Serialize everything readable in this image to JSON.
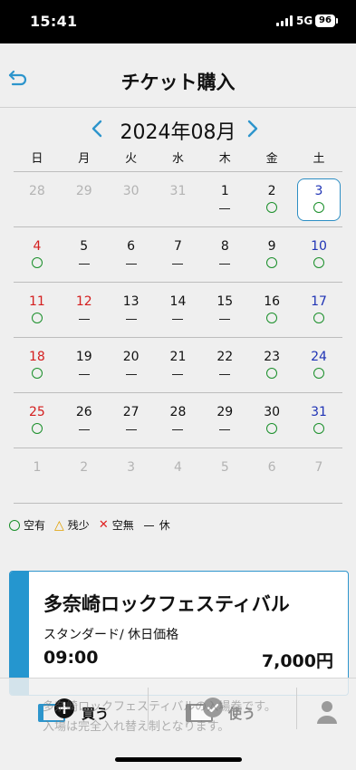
{
  "status_bar": {
    "time": "15:41",
    "network": "5G",
    "battery": "96"
  },
  "header": {
    "title": "チケット購入"
  },
  "calendar": {
    "month_label": "2024年08月",
    "weekdays": [
      "日",
      "月",
      "火",
      "水",
      "木",
      "金",
      "土"
    ],
    "weeks": [
      [
        {
          "d": "28",
          "s": "",
          "t": "muted"
        },
        {
          "d": "29",
          "s": "",
          "t": "muted"
        },
        {
          "d": "30",
          "s": "",
          "t": "muted"
        },
        {
          "d": "31",
          "s": "",
          "t": "muted"
        },
        {
          "d": "1",
          "s": "—",
          "t": ""
        },
        {
          "d": "2",
          "s": "○",
          "t": ""
        },
        {
          "d": "3",
          "s": "○",
          "t": "sat selected"
        }
      ],
      [
        {
          "d": "4",
          "s": "○",
          "t": "sun"
        },
        {
          "d": "5",
          "s": "—",
          "t": ""
        },
        {
          "d": "6",
          "s": "—",
          "t": ""
        },
        {
          "d": "7",
          "s": "—",
          "t": ""
        },
        {
          "d": "8",
          "s": "—",
          "t": ""
        },
        {
          "d": "9",
          "s": "○",
          "t": ""
        },
        {
          "d": "10",
          "s": "○",
          "t": "sat"
        }
      ],
      [
        {
          "d": "11",
          "s": "○",
          "t": "sun"
        },
        {
          "d": "12",
          "s": "—",
          "t": "sun"
        },
        {
          "d": "13",
          "s": "—",
          "t": ""
        },
        {
          "d": "14",
          "s": "—",
          "t": ""
        },
        {
          "d": "15",
          "s": "—",
          "t": ""
        },
        {
          "d": "16",
          "s": "○",
          "t": ""
        },
        {
          "d": "17",
          "s": "○",
          "t": "sat"
        }
      ],
      [
        {
          "d": "18",
          "s": "○",
          "t": "sun"
        },
        {
          "d": "19",
          "s": "—",
          "t": ""
        },
        {
          "d": "20",
          "s": "—",
          "t": ""
        },
        {
          "d": "21",
          "s": "—",
          "t": ""
        },
        {
          "d": "22",
          "s": "—",
          "t": ""
        },
        {
          "d": "23",
          "s": "○",
          "t": ""
        },
        {
          "d": "24",
          "s": "○",
          "t": "sat"
        }
      ],
      [
        {
          "d": "25",
          "s": "○",
          "t": "sun"
        },
        {
          "d": "26",
          "s": "—",
          "t": ""
        },
        {
          "d": "27",
          "s": "—",
          "t": ""
        },
        {
          "d": "28",
          "s": "—",
          "t": ""
        },
        {
          "d": "29",
          "s": "—",
          "t": ""
        },
        {
          "d": "30",
          "s": "○",
          "t": ""
        },
        {
          "d": "31",
          "s": "○",
          "t": "sat"
        }
      ],
      [
        {
          "d": "1",
          "s": "",
          "t": "muted"
        },
        {
          "d": "2",
          "s": "",
          "t": "muted"
        },
        {
          "d": "3",
          "s": "",
          "t": "muted"
        },
        {
          "d": "4",
          "s": "",
          "t": "muted"
        },
        {
          "d": "5",
          "s": "",
          "t": "muted"
        },
        {
          "d": "6",
          "s": "",
          "t": "muted"
        },
        {
          "d": "7",
          "s": "",
          "t": "muted"
        }
      ]
    ]
  },
  "legend": {
    "available": "空有",
    "few": "残少",
    "none": "空無",
    "closed": "休",
    "few_symbol": "△",
    "none_symbol": "✕"
  },
  "ticket": {
    "title": "多奈崎ロックフェスティバル",
    "type": "スタンダード/ 休日価格",
    "time": "09:00",
    "price": "7,000円",
    "note_line1": "多奈崎ロックフェスティバルの入場券です。",
    "note_line2": "入場は完全入れ替え制となります。"
  },
  "bottom_nav": {
    "buy": "買う",
    "use": "使う"
  },
  "colors": {
    "accent": "#2596cf",
    "available": "#1a8f2a",
    "sunday": "#d41e1e",
    "saturday": "#1f33b5",
    "none": "#e02020",
    "few": "#e0a000"
  }
}
